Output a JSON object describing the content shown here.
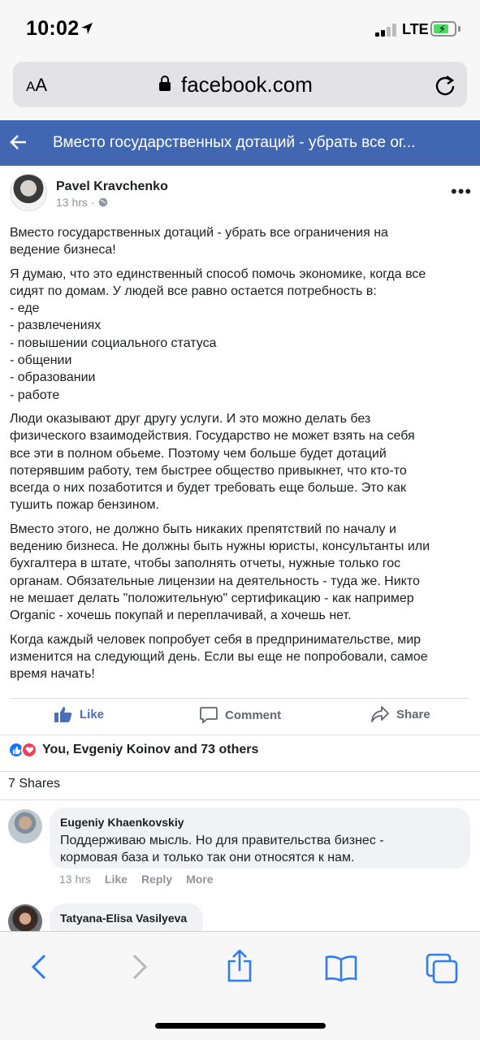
{
  "status": {
    "time": "10:02",
    "network": "LTE"
  },
  "browser": {
    "text_size": "AA",
    "url": "facebook.com"
  },
  "header": {
    "title": "Вместо государственных дотаций - убрать все ог..."
  },
  "post": {
    "author": "Pavel Kravchenko",
    "time": "13 hrs",
    "separator": "·",
    "paragraphs": [
      [
        "Вместо государственных дотаций - убрать все ограничения на",
        "ведение бизнеса!"
      ],
      [
        "Я думаю, что это единственный способ помочь экономике, когда все",
        "сидят по домам. У людей все равно остается потребность в:",
        "- еде",
        "- развлечениях",
        "- повышении социального статуса",
        "- общении",
        "- образовании",
        "- работе"
      ],
      [
        "Люди оказывают друг другу услуги. И это можно делать без",
        "физического взаимодействия. Государство не может взять на себя",
        "все эти в полном обьеме. Поэтому чем больше будет дотаций",
        "потерявшим работу, тем быстрее общество привыкнет, что кто-то",
        "всегда о них позаботится и будет требовать еще больше. Это как",
        "тушить пожар бензином."
      ],
      [
        "Вместо этого, не должно быть никаких препятствий по началу и",
        "ведению бизнеса. Не должны быть нужны юристы, консультанты или",
        "бухгалтера в штате, чтобы заполнять отчеты, нужные только гос",
        "органам. Обязательные лицензии на деятельность - туда же. Никто",
        "не мешает делать \"положительную\" сертификацию - как например",
        "Organic - хочешь покупай и переплачивай, а хочешь нет."
      ],
      [
        "Когда каждый человек попробует себя в предпринимательстве, мир",
        "изменится на следующий день. Если вы еще не попробовали, самое",
        "время начать!"
      ]
    ],
    "actions": {
      "like": "Like",
      "comment": "Comment",
      "share": "Share"
    },
    "reactions": "You, Evgeniy Koinov and 73 others",
    "shares": "7 Shares"
  },
  "comments": [
    {
      "name": "Eugeniy Khaenkovskiy",
      "lines": [
        "Поддерживаю мысль. Но для правительства бизнес -",
        "кормовая база и только так они относятся к нам."
      ],
      "time": "13 hrs",
      "like": "Like",
      "reply": "Reply",
      "more": "More"
    },
    {
      "name": "Tatyana-Elisa Vasilyeva"
    }
  ],
  "colors": {
    "fb_blue": "#4267b2",
    "like_blue": "#1877f2",
    "love_red": "#f33e58",
    "battery_green": "#4cd964"
  }
}
